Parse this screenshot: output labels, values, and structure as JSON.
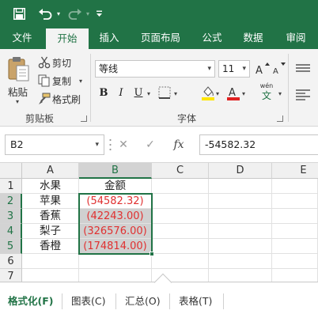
{
  "quick_access": {
    "save_icon": "save-icon",
    "undo_icon": "undo-icon",
    "redo_icon": "redo-icon",
    "customize_icon": "customize-qat-icon"
  },
  "tabs": [
    {
      "label": "文件"
    },
    {
      "label": "开始"
    },
    {
      "label": "插入"
    },
    {
      "label": "页面布局"
    },
    {
      "label": "公式"
    },
    {
      "label": "数据"
    },
    {
      "label": "审阅"
    }
  ],
  "ribbon": {
    "clipboard": {
      "paste": "粘贴",
      "cut": "剪切",
      "copy": "复制",
      "format_painter": "格式刷",
      "group_label": "剪贴板"
    },
    "font": {
      "font_name": "等线",
      "font_size": "11",
      "bold": "B",
      "italic": "I",
      "underline": "U",
      "wen": "wén",
      "wen_char": "文",
      "group_label": "字体",
      "fill_color": "#ffe600",
      "font_color": "#e02020"
    }
  },
  "formula_bar": {
    "name_box": "B2",
    "cancel_icon": "✕",
    "enter_icon": "✓",
    "fx_icon": "fx",
    "value": "-54582.32"
  },
  "sheet": {
    "columns": [
      "A",
      "B",
      "C",
      "D",
      "E"
    ],
    "rows": [
      "1",
      "2",
      "3",
      "4",
      "5",
      "6",
      "7"
    ],
    "cells": {
      "A1": "水果",
      "B1": "金额",
      "A2": "苹果",
      "B2": "(54582.32)",
      "A3": "香蕉",
      "B3": "(42243.00)",
      "A4": "梨子",
      "B4": "(326576.00)",
      "A5": "香橙",
      "B5": "(174814.00)"
    },
    "negative_color": "#e03030",
    "selection": "B2:B5"
  },
  "quick_analysis": {
    "tabs": [
      {
        "label": "格式化(F)"
      },
      {
        "label": "图表(C)"
      },
      {
        "label": "汇总(O)"
      },
      {
        "label": "表格(T)"
      }
    ]
  },
  "theme": {
    "accent": "#217346"
  }
}
